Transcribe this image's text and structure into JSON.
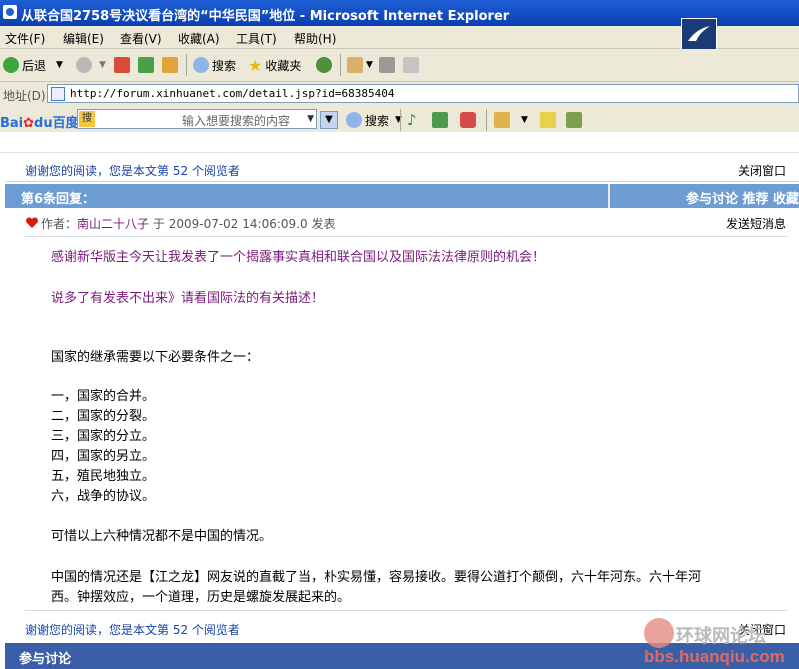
{
  "window": {
    "title": "从联合国2758号决议看台湾的“中华民国”地位 - Microsoft Internet Explorer"
  },
  "menu": [
    "文件(F)",
    "编辑(E)",
    "查看(V)",
    "收藏(A)",
    "工具(T)",
    "帮助(H)"
  ],
  "toolbar": {
    "back_label": "后退",
    "search_label": "搜索",
    "favorites_label": "收藏夹"
  },
  "address": {
    "label": "地址(D)",
    "url": "http://forum.xinhuanet.com/detail.jsp?id=68385404"
  },
  "baidu": {
    "logo_prefix": "Bai",
    "logo_mid": "du",
    "logo_suffix": "百度",
    "prefix_icon": "搜",
    "placeholder": "输入想要搜索的内容",
    "search_label": "搜索"
  },
  "page": {
    "thanks_text": "谢谢您的阅读，您是本文第 52 个阅览者",
    "close_label": "关闭窗口",
    "reply_title": "第6条回复：",
    "reply_actions": "参与讨论  推荐  收藏",
    "author_prefix": "作者：",
    "author_name": "南山二十八子",
    "author_mid": "于",
    "post_time": "2009-07-02 14:06:09.0",
    "post_suffix": "发表",
    "send_msg": "发送短消息",
    "lines": [
      "感谢新华版主今天让我发表了一个揭露事实真相和联合国以及国际法法律原则的机会！",
      "说多了有发表不出来》请看国际法的有关描述！",
      "国家的继承需要以下必要条件之一：",
      "一，国家的合并。",
      "二，国家的分裂。",
      "三，国家的分立。",
      "四，国家的另立。",
      "五，殖民地独立。",
      "六，战争的协议。",
      "可惜以上六种情况都不是中国的情况。",
      "中国的情况还是【江之龙】网友说的直截了当，朴实易懂，容易接收。要得公道打个颠倒，六十年河东。六十年河",
      "西。钟摆效应，一个道理，历史是螺旋发展起来的。"
    ],
    "bottom_label": "参与讨论"
  },
  "watermark": {
    "cn": "环球网论坛",
    "url": "bbs.huanqiu.com"
  }
}
